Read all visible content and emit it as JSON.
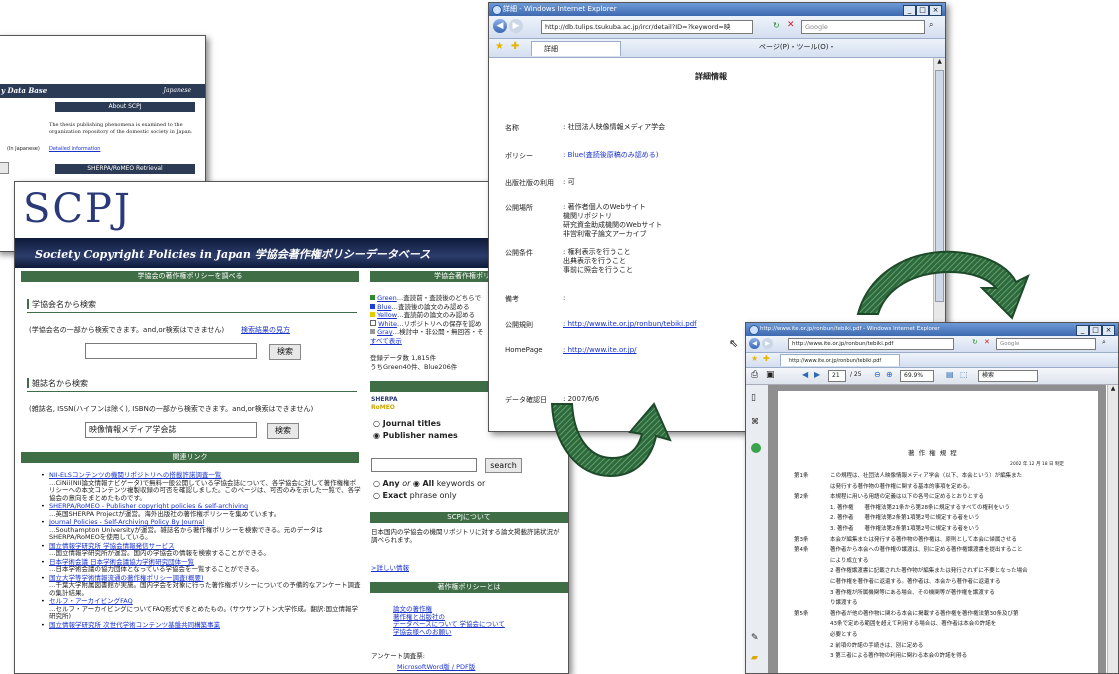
{
  "back_window": {
    "header_left": "y Data Base",
    "header_right": "Japanese",
    "about_title": "About SCPJ",
    "about_text_1": "The thesis publishing phenomena is examined to the",
    "about_text_2": "organization repository of the domestic society in Japan.",
    "in_japanese": "(In Japanese)",
    "detailed_info": "Detailed information",
    "sherpa_title": "SHERPA/RoMEO Retrieval"
  },
  "scpj": {
    "logo": "SCPJ",
    "banner": "Society Copyright Policies in Japan 学協会著作権ポリシーデータベース",
    "search_header": "学協会の著作権ポリシーを調べる",
    "society_search_title": "学協会名から検索",
    "society_hint": "(学協会名の一部から検索できます。and,or検索はできません)",
    "society_hint_link": "検索結果の見方",
    "search_button": "検索",
    "journal_search_title": "雑誌名から検索",
    "journal_hint": "(雑誌名, ISSN(ハイフンは除く), ISBNの一部から検索できます。and,or検索はできません)",
    "journal_input_value": "映像情報メディア学会誌",
    "related_header": "関連リンク",
    "links": [
      {
        "title": "NII-ELSコンテンツの機関リポジトリへの搭載許諾調査一覧",
        "desc": "…CiNii(NII論文情報ナビゲータ)で無料一般公開している学協会誌について、各学協会に対して著作権権ポリシーへの本文コンテンツ複製収録の可否を確認しました。このページは、可否のみを示した一覧で、各学協会の意向をまとめたものです。"
      },
      {
        "title": "SHERPA/RoMEO - Publisher copyright policies & self-archiving",
        "desc": "…英国SHERPA Projectが運営。海外出版社の著作権ポリシーを集めています。"
      },
      {
        "title": "Journal Policies - Self-Archiving Policy By Journal",
        "desc": "…Southampton Universityが運営。雑誌名から著作権ポリシーを検索できる。元のデータはSHERPA/RoMEOを使用している。"
      },
      {
        "title": "国立情報学研究所 学協会情報発信サービス",
        "desc": "…国立情報学研究所が運営。国内の学協会の情報を検索することができる。"
      },
      {
        "title": "日本学術会議 日本学術会議協力学術研究団体一覧",
        "desc": "…日本学術会議の協力団体となっている学協会を一覧することができる。"
      },
      {
        "title": "国立大学等学術情報流通の著作権ポリシー調査(概要)",
        "desc": "…千葉大学附属図書館が実施。国内学会を対象に行った著作権ポリシーについての予備的なアンケート調査の集計結果。"
      },
      {
        "title": "セルフ・アーカイビングFAQ",
        "desc": "…セルフ・アーカイビングについてFAQ形式でまとめたもの。(サウサンプトン大学作成。翻訳:国立情報学研究所)"
      },
      {
        "title": "国立情報学研究所 次世代学術コンテンツ基盤共同構築事業",
        "desc": ""
      }
    ],
    "policy_header": "学協会著作権ポリシー",
    "colors": [
      {
        "name": "Green",
        "hex": "#2e8b2e",
        "desc": "…査読前・査読後のどちらで"
      },
      {
        "name": "Blue",
        "hex": "#1a3fd6",
        "desc": "…査読後の論文のみ認める"
      },
      {
        "name": "Yellow",
        "hex": "#e8c800",
        "desc": "…査読前の論文のみ認める"
      },
      {
        "name": "White",
        "hex": "#ffffff",
        "desc": "…リポジトリへの保存を認め"
      },
      {
        "name": "Gray",
        "hex": "#999999",
        "desc": "…検討中・非公開・無回答・そ"
      }
    ],
    "show_all": "すべて表示",
    "count_line_1": "登録データ数  1,815件",
    "count_line_2": "うちGreen40件、Blue206件",
    "sherpa_header": "SHERPA/RoMEO 検",
    "romeo_logo_1": "SHERPA",
    "romeo_logo_2": "RoMEO",
    "radio_journal": "Journal titles",
    "radio_publisher": "Publisher names",
    "sherpa_search_button": "search",
    "any": "Any",
    "or_word": "or",
    "all": "All",
    "keywords_or": "keywords or",
    "exact": "Exact",
    "phrase_only": "phrase only",
    "about_header": "SCPJについて",
    "about_text": "日本国内の学協会の機関リポジトリに対する論文掲載許諾状況が調べられます。",
    "more_link": ">詳しい情報",
    "what_header": "著作権ポリシーとは",
    "what_links": [
      "論文の著作権",
      "著作権と出版社の",
      "データベースについて 学協会について",
      "学協会様へのお願い"
    ],
    "survey_label": "アンケート調査票:",
    "survey_links": "MicrosoftWord版 / PDF版"
  },
  "detail_window": {
    "title": "詳細 - Windows Internet Explorer",
    "url": "http://db.tulips.tsukuba.ac.jp/ircr/detail?ID=?keyword=映",
    "search_placeholder": "Google",
    "tab": "詳細",
    "toolbar_text": "ページ(P)・ツール(O)・",
    "heading": "詳細情報",
    "fields": [
      {
        "label": "名称",
        "value": ": 社団法人映像情報メディア学会",
        "type": "text"
      },
      {
        "label": "ポリシー",
        "value": ": Blue(査読後原稿のみ認める)",
        "type": "blue"
      },
      {
        "label": "出版社版の利用",
        "value": ": 可",
        "type": "text"
      },
      {
        "label": "公開場所",
        "value": ": 著作者個人のWebサイト\n機関リポジトリ\n研究資金助成機関のWebサイト\n非営利電子論文アーカイブ",
        "type": "text"
      },
      {
        "label": "公開条件",
        "value": ": 権利表示を行うこと\n出典表示を行うこと\n事前に照会を行うこと",
        "type": "text"
      },
      {
        "label": "備考",
        "value": ":",
        "type": "text"
      },
      {
        "label": "公開規則",
        "value": ": http://www.ite.or.jp/ronbun/tebiki.pdf",
        "type": "link"
      },
      {
        "label": "HomePage",
        "value": ": http://www.ite.or.jp/",
        "type": "link"
      },
      {
        "label": "データ確認日",
        "value": ": 2007/6/6",
        "type": "text"
      }
    ]
  },
  "pdf_window": {
    "title": "http://www.ite.or.jp/ronbun/tebiki.pdf - Windows Internet Explorer",
    "url": "http://www.ite.or.jp/ronbun/tebiki.pdf",
    "search_placeholder": "Google",
    "tab": "http://www.ite.or.jp/ronbun/tebiki.pdf",
    "page_current": "21",
    "page_total": "/ 25",
    "zoom": "69.9%",
    "find_value": "検索",
    "doc_title": "著 作 権 規 程",
    "doc_date": "2002 年 12 月 18 日 制定",
    "articles": [
      {
        "num": "第1条",
        "text": "この規程は、社団法人映像情報メディア学会（以下、本会という）が編集また"
      },
      {
        "num": "",
        "text": "は発行する著作物の著作権に関する基本的事項を定める。"
      },
      {
        "num": "第2条",
        "text": "本規程に用いる用語の定義は以下の各号に定めるとおりとする"
      },
      {
        "num": "",
        "text": "1. 著作権　　著作権法第21条から第28条に規定するすべての権利をいう"
      },
      {
        "num": "",
        "text": "2. 著作者　　著作権法第2条第1項第2号に規定する者をいう"
      },
      {
        "num": "",
        "text": "3. 著作者　　著作権法第2条第1項第2号に規定する者をいう"
      },
      {
        "num": "第3条",
        "text": "本会が編集または発行する著作物の著作権は、原則として本会に帰属させる"
      },
      {
        "num": "第4条",
        "text": "著作者から本会への著作権の譲渡は、別に定める著作権譲渡書を提出すること"
      },
      {
        "num": "",
        "text": "により成立する"
      },
      {
        "num": "",
        "text": "2 著作権譲渡書に記載された著作物が編集または発行されずに不要となった場合"
      },
      {
        "num": "",
        "text": "に著作権を著作者に返還する。著作者は、本会から著作者に返還する"
      },
      {
        "num": "",
        "text": "3 著作権が所属機関等にある場合、その機関等が著作権を譲渡する"
      },
      {
        "num": "",
        "text": "り譲渡する"
      },
      {
        "num": "第5条",
        "text": "著作者が他の著作物に関わる本会に掲載する著作権を著作権法第30条及び第"
      },
      {
        "num": "",
        "text": "43条で定める範囲を超えて利用する場合は、著作者は本会の許諾を"
      },
      {
        "num": "",
        "text": "必要とする"
      },
      {
        "num": "",
        "text": "2 前項の許諾の手続きは、別に定める"
      },
      {
        "num": "",
        "text": "3 第三者による著作物の利用に関わる本会の許諾を得る"
      }
    ]
  }
}
